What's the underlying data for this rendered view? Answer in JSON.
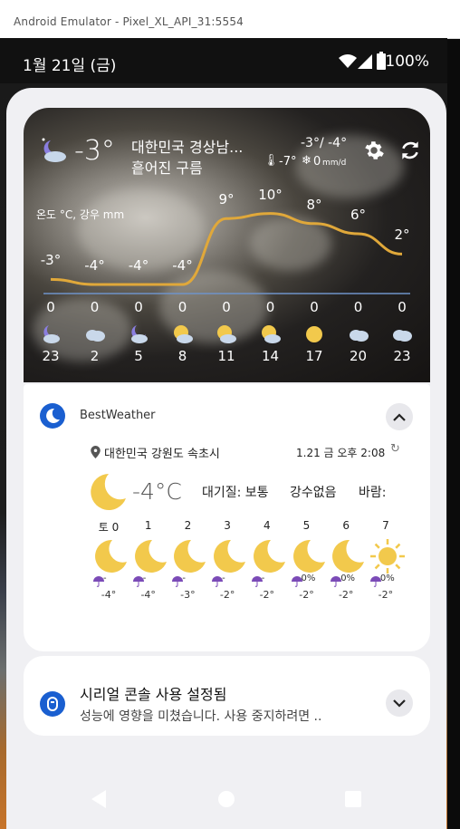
{
  "window": {
    "title": "Android Emulator - Pixel_XL_API_31:5554"
  },
  "status_bar": {
    "time": "1월 21일 (금)",
    "battery": "100%"
  },
  "weather_widget": {
    "current_temp": "-3°",
    "location": "대한민국 경상남...",
    "condition": "흩어진 구름",
    "hi_lo": "-3°/ -4°",
    "feels_like": "-7°",
    "precip": "0",
    "precip_unit": "mm/d",
    "chart_label": "온도 °C, 강우 mm",
    "hourly": [
      {
        "temp": "-3°",
        "rain": "0",
        "icon": "moon-cloud-icon",
        "hour": "23"
      },
      {
        "temp": "-4°",
        "rain": "0",
        "icon": "cloud-icon",
        "hour": "2"
      },
      {
        "temp": "-4°",
        "rain": "0",
        "icon": "moon-cloud-icon",
        "hour": "5"
      },
      {
        "temp": "-4°",
        "rain": "0",
        "icon": "sun-cloud-icon",
        "hour": "8"
      },
      {
        "temp": "9°",
        "rain": "0",
        "icon": "sun-cloud-icon",
        "hour": "11"
      },
      {
        "temp": "10°",
        "rain": "0",
        "icon": "sun-cloud-icon",
        "hour": "14"
      },
      {
        "temp": "8°",
        "rain": "0",
        "icon": "sun-icon",
        "hour": "17"
      },
      {
        "temp": "6°",
        "rain": "0",
        "icon": "cloud-icon",
        "hour": "20"
      },
      {
        "temp": "2°",
        "rain": "0",
        "icon": "cloud-icon",
        "hour": "23"
      }
    ]
  },
  "notification": {
    "app_name": "BestWeather",
    "location": "대한민국 강원도 속초시",
    "updated": "1.21 금 오후 2:08",
    "temp": "-4°C",
    "air_quality": "대기질: 보통",
    "rain_status": "강수없음",
    "wind_label": "바람:",
    "daily": [
      {
        "day": "토 0",
        "rain": "-",
        "temp": "-4°",
        "icon": "moon-icon"
      },
      {
        "day": "1",
        "rain": "-",
        "temp": "-4°",
        "icon": "moon-icon"
      },
      {
        "day": "2",
        "rain": "-",
        "temp": "-3°",
        "icon": "moon-icon"
      },
      {
        "day": "3",
        "rain": "-",
        "temp": "-2°",
        "icon": "moon-icon"
      },
      {
        "day": "4",
        "rain": "-",
        "temp": "-2°",
        "icon": "moon-icon"
      },
      {
        "day": "5",
        "rain": "0%",
        "temp": "-2°",
        "icon": "moon-icon"
      },
      {
        "day": "6",
        "rain": "0%",
        "temp": "-2°",
        "icon": "moon-icon"
      },
      {
        "day": "7",
        "rain": "0%",
        "temp": "-2°",
        "icon": "sun-icon"
      }
    ]
  },
  "serial_notification": {
    "title": "시리얼 콘솔 사용 설정됨",
    "body": "성능에 영향을 미쳤습니다. 사용 중지하려면 .."
  },
  "colors": {
    "accent": "#1a5fd0",
    "moon": "#f2c94c",
    "chart_line": "#e0a83a"
  }
}
